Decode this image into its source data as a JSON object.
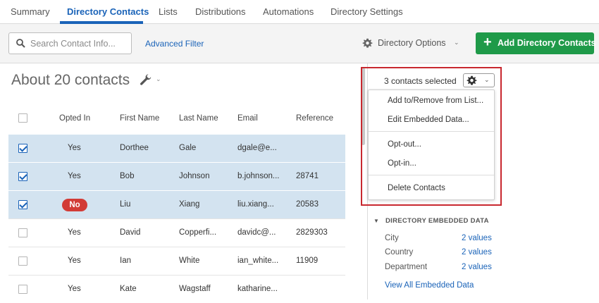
{
  "tabs": [
    {
      "label": "Summary"
    },
    {
      "label": "Directory Contacts"
    },
    {
      "label": "Lists"
    },
    {
      "label": "Distributions"
    },
    {
      "label": "Automations"
    },
    {
      "label": "Directory Settings"
    }
  ],
  "toolbar": {
    "search_placeholder": "Search Contact Info...",
    "advanced_filter": "Advanced Filter",
    "directory_options": "Directory Options",
    "add_button": "Add Directory Contacts"
  },
  "main": {
    "title": "About 20 contacts",
    "columns": [
      "Opted In",
      "First Name",
      "Last Name",
      "Email",
      "Reference"
    ],
    "rows": [
      {
        "checked": true,
        "opted_in": "Yes",
        "first": "Dorthee",
        "last": "Gale",
        "email": "dgale@e...",
        "reference": ""
      },
      {
        "checked": true,
        "opted_in": "Yes",
        "first": "Bob",
        "last": "Johnson",
        "email": "b.johnson...",
        "reference": "28741"
      },
      {
        "checked": true,
        "opted_in": "No",
        "first": "Liu",
        "last": "Xiang",
        "email": "liu.xiang...",
        "reference": "20583"
      },
      {
        "checked": false,
        "opted_in": "Yes",
        "first": "David",
        "last": "Copperfi...",
        "email": "davidc@...",
        "reference": "2829303"
      },
      {
        "checked": false,
        "opted_in": "Yes",
        "first": "Ian",
        "last": "White",
        "email": "ian_white...",
        "reference": "11909"
      },
      {
        "checked": false,
        "opted_in": "Yes",
        "first": "Kate",
        "last": "Wagstaff",
        "email": "katharine...",
        "reference": ""
      }
    ]
  },
  "side": {
    "selected": "3 contacts selected",
    "menu": [
      "Add to/Remove from List...",
      "Edit Embedded Data...",
      "Opt-out...",
      "Opt-in...",
      "Delete Contacts"
    ],
    "embedded_title": "DIRECTORY EMBEDDED DATA",
    "embedded": [
      {
        "key": "City",
        "value": "2 values"
      },
      {
        "key": "Country",
        "value": "2 values"
      },
      {
        "key": "Department",
        "value": "2 values"
      }
    ],
    "view_all": "View All Embedded Data"
  },
  "colors": {
    "accent": "#1a63b8",
    "add_green": "#1f9a49",
    "badge_red": "#d23b36",
    "selected_row": "#d3e3f0",
    "highlight": "#c8282f"
  },
  "icons": [
    "search-icon",
    "gear-icon",
    "wrench-icon",
    "chevron-down-icon",
    "plus-icon",
    "checkbox-icon",
    "triangle-down-icon"
  ]
}
